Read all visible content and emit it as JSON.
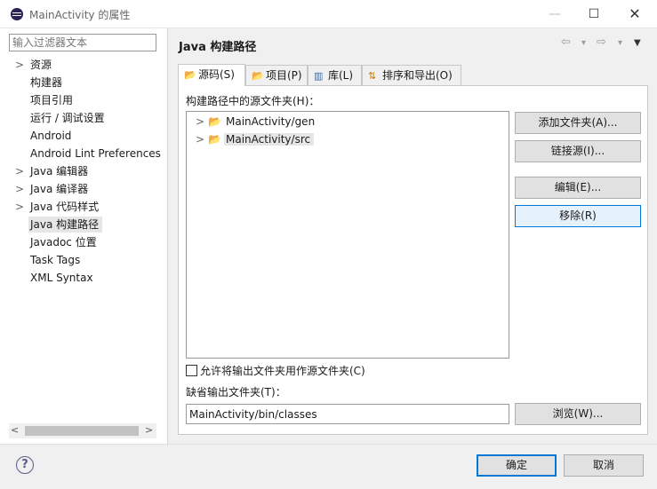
{
  "window": {
    "title": "MainActivity 的属性",
    "minimize_glyph": "—",
    "maximize_glyph": "☐",
    "close_glyph": "✕"
  },
  "sidebar": {
    "filter_placeholder": "输入过滤器文本",
    "items": [
      {
        "label": "资源",
        "expandable": true
      },
      {
        "label": "构建器",
        "expandable": false
      },
      {
        "label": "项目引用",
        "expandable": false
      },
      {
        "label": "运行 / 调试设置",
        "expandable": false
      },
      {
        "label": "Android",
        "expandable": false
      },
      {
        "label": "Android Lint Preferences",
        "expandable": false
      },
      {
        "label": "Java 编辑器",
        "expandable": true
      },
      {
        "label": "Java 编译器",
        "expandable": true
      },
      {
        "label": "Java 代码样式",
        "expandable": true
      },
      {
        "label": "Java 构建路径",
        "expandable": false,
        "selected": true
      },
      {
        "label": "Javadoc 位置",
        "expandable": false
      },
      {
        "label": "Task Tags",
        "expandable": false
      },
      {
        "label": "XML Syntax",
        "expandable": false
      }
    ],
    "chevron_glyph": ">",
    "scroll_left_glyph": "<",
    "scroll_right_glyph": ">"
  },
  "page": {
    "title": "Java 构建路径",
    "back_icon": "⇦",
    "forward_icon": "⇨",
    "dropdown_icon": "▾",
    "menu_icon": "▼"
  },
  "tabs": [
    {
      "label": "源码(S)",
      "icon": "folder-icon",
      "active": true
    },
    {
      "label": "项目(P)",
      "icon": "project-icon",
      "active": false
    },
    {
      "label": "库(L)",
      "icon": "library-icon",
      "active": false
    },
    {
      "label": "排序和导出(O)",
      "icon": "order-icon",
      "active": false
    }
  ],
  "source": {
    "section_label": "构建路径中的源文件夹(H)：",
    "folders": [
      {
        "label": "MainActivity/gen",
        "selected": false
      },
      {
        "label": "MainActivity/src",
        "selected": true
      }
    ],
    "buttons": {
      "add_folder": "添加文件夹(A)...",
      "link_source": "链接源(I)...",
      "edit": "编辑(E)...",
      "remove": "移除(R)"
    },
    "allow_output_label": "允许将输出文件夹用作源文件夹(C)",
    "default_output_label": "缺省输出文件夹(T)：",
    "default_output_value": "MainActivity/bin/classes",
    "browse": "浏览(W)..."
  },
  "footer": {
    "help_glyph": "?",
    "ok": "确定",
    "cancel": "取消"
  }
}
